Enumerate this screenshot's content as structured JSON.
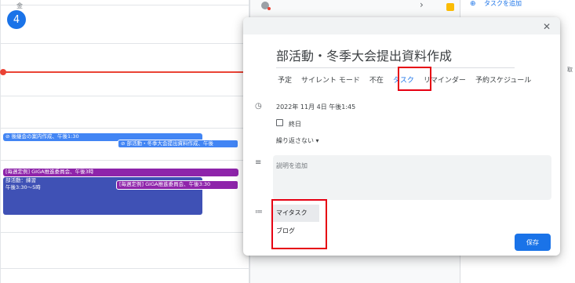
{
  "calendar": {
    "day_label": "金",
    "day_number": "4",
    "events": [
      {
        "label": "⊘ 後継会の案内作成、午後1:30"
      },
      {
        "label": "⊘ 部活動・冬季大会提出資料作成、午後"
      },
      {
        "label": "[毎週定例] GIGA推進委員会、午後3時"
      },
      {
        "label": "[毎週定例] GIGA推進委員会、午後3:30"
      },
      {
        "label_line1": "部活動：練習",
        "label_line2": "午後3:30〜5時"
      }
    ]
  },
  "side_panel": {
    "add_task_label": "タスクを追加",
    "edge_text": "取"
  },
  "dialog": {
    "title": "部活動・冬季大会提出資料作成",
    "tabs": [
      "予定",
      "サイレント モード",
      "不在",
      "タスク",
      "リマインダー",
      "予約スケジュール"
    ],
    "active_tab": "タスク",
    "datetime": "2022年 11月 4日   午後1:45",
    "all_day_label": "終日",
    "repeat_label": "繰り返さない ▾",
    "description_placeholder": "説明を追加",
    "task_lists": [
      "マイタスク",
      "ブログ"
    ],
    "save_label": "保存"
  },
  "colors": {
    "accent": "#1a73e8",
    "highlight_box": "#e60012",
    "now_line": "#ea4335",
    "event_blue": "#4285f4",
    "event_purple": "#8e24aa",
    "event_indigo": "#3f51b5"
  }
}
